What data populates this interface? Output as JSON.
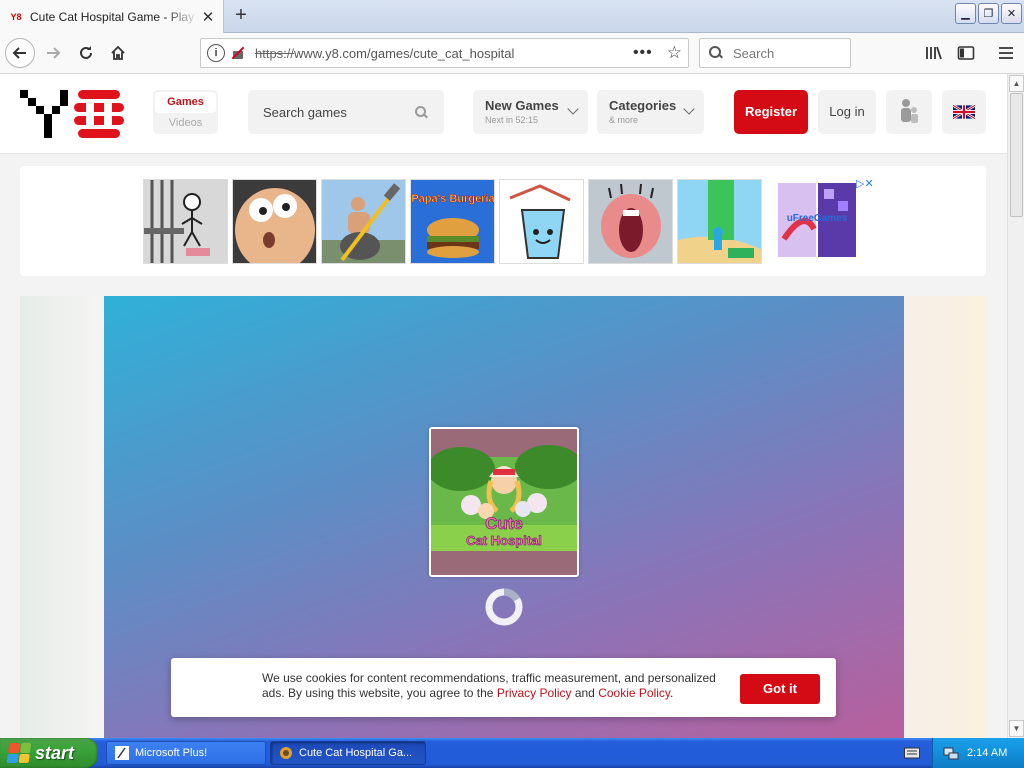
{
  "browser": {
    "tab_title": "Cute Cat Hospital Game - Play online",
    "tab_favicon": "Y8",
    "url_protocol": "https://",
    "url_rest": "www.y8.com/games/cute_cat_hospital",
    "search_placeholder": "Search",
    "window_buttons": [
      "minimize",
      "restore",
      "close"
    ]
  },
  "site": {
    "nav_games": "Games",
    "nav_videos": "Videos",
    "search_placeholder": "Search games",
    "new_games_label": "New Games",
    "new_games_sub": "Next in 52:15",
    "categories_label": "Categories",
    "categories_sub": "& more",
    "register_label": "Register",
    "login_label": "Log in",
    "accent_color": "#d40b14"
  },
  "ads": {
    "tiles": [
      "stickman-jail",
      "cartoon-face",
      "hammer-climber",
      "papas-burgeria",
      "happy-glass",
      "mouth-game",
      "stack-runner"
    ],
    "burger_tile_text": "Papa's Burgeria",
    "side_ad_text": "uFreeGames"
  },
  "game": {
    "title_line1": "Cute",
    "title_line2": "Cat Hospital"
  },
  "cookie": {
    "text_before": "We use cookies for content recommendations, traffic measurement, and personalized ads. By using this website, you agree to the ",
    "privacy_link": "Privacy Policy",
    "and_text": " and ",
    "cookie_link": "Cookie Policy",
    "end_text": ".",
    "button_label": "Got it"
  },
  "taskbar": {
    "start_label": "start",
    "task1_label": "Microsoft Plus!",
    "task2_label": "Cute Cat Hospital Ga...",
    "clock": "2:14 AM"
  }
}
